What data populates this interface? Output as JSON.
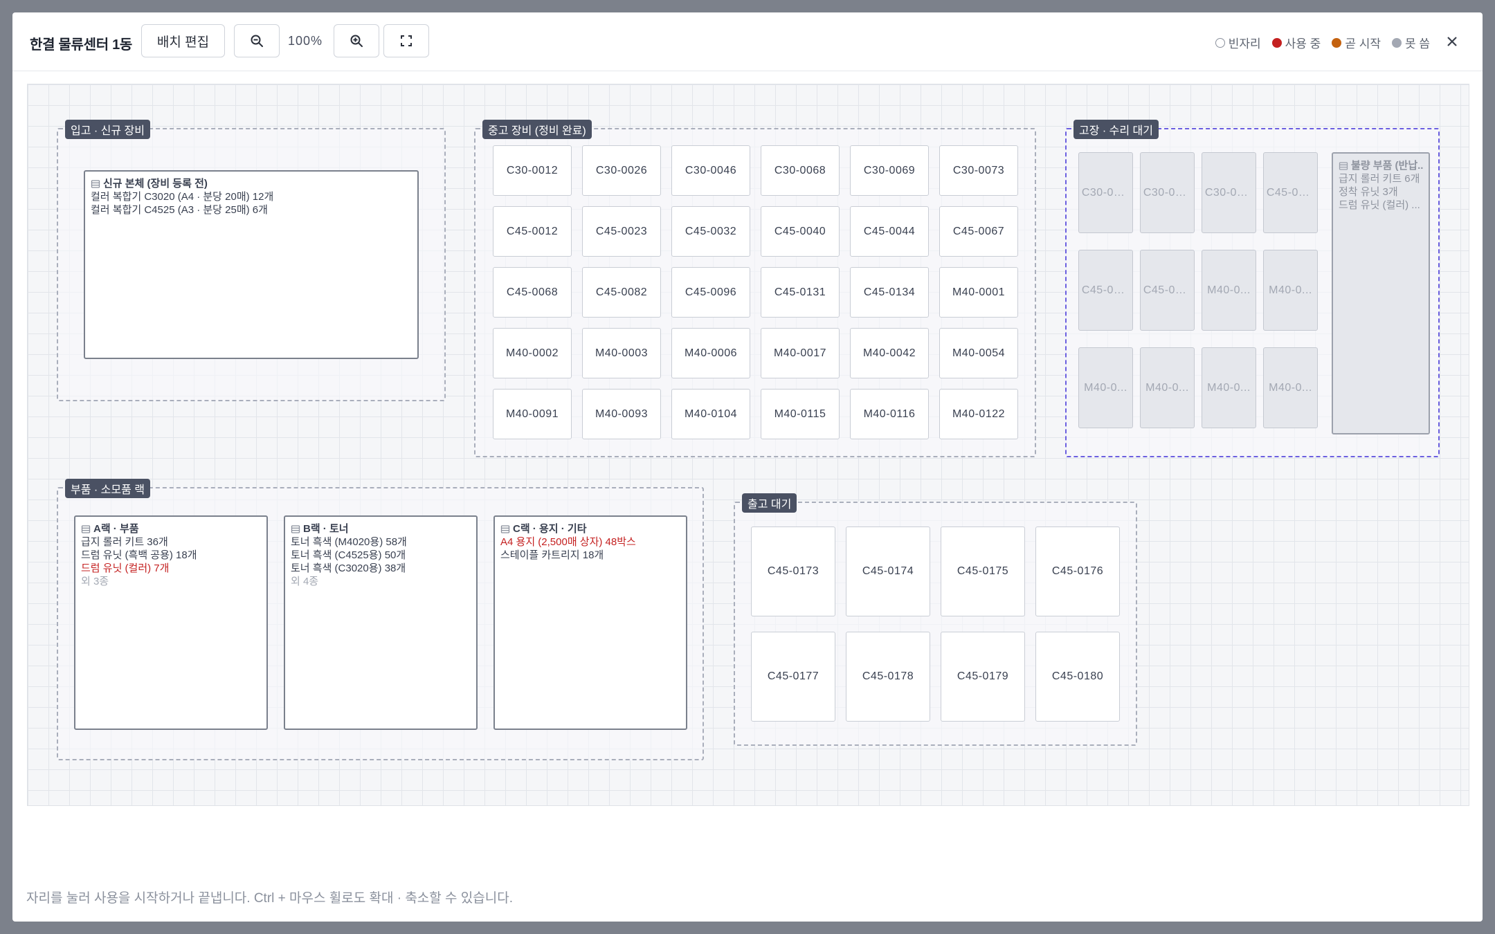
{
  "header": {
    "title": "한결 물류센터 1동",
    "edit_label": "배치 편집",
    "zoom_level": "100%",
    "zoom_out_icon": "zoom-out-icon",
    "zoom_in_icon": "zoom-in-icon",
    "fullscreen_icon": "fullscreen-icon",
    "close_icon": "close-icon"
  },
  "legend": [
    {
      "label": "빈자리",
      "color": "#ffffff",
      "border": "#8a909c"
    },
    {
      "label": "사용 중",
      "color": "#c42020",
      "border": "#c42020"
    },
    {
      "label": "곧 시작",
      "color": "#c4620f",
      "border": "#c4620f"
    },
    {
      "label": "못 씀",
      "color": "#a3a8b3",
      "border": "#a3a8b3"
    }
  ],
  "zones": {
    "intake": {
      "label": "입고 · 신규 장비",
      "box": {
        "title": "신규 본체 (장비 등록 전)",
        "lines": [
          "컬러 복합기 C3020 (A4 · 분당 20매) 12개",
          "컬러 복합기 C4525 (A3 · 분당 25매) 6개"
        ]
      }
    },
    "used": {
      "label": "중고 장비 (정비 완료)",
      "seats": [
        "C30-0012",
        "C30-0026",
        "C30-0046",
        "C30-0068",
        "C30-0069",
        "C30-0073",
        "C45-0012",
        "C45-0023",
        "C45-0032",
        "C45-0040",
        "C45-0044",
        "C45-0067",
        "C45-0068",
        "C45-0082",
        "C45-0096",
        "C45-0131",
        "C45-0134",
        "M40-0001",
        "M40-0002",
        "M40-0003",
        "M40-0006",
        "M40-0017",
        "M40-0042",
        "M40-0054",
        "M40-0091",
        "M40-0093",
        "M40-0104",
        "M40-0115",
        "M40-0116",
        "M40-0122"
      ]
    },
    "repair": {
      "label": "고장 · 수리 대기",
      "seats": [
        "C30-00...",
        "C30-00...",
        "C30-00...",
        "C45-00...",
        "C45-00...",
        "C45-00...",
        "M40-0...",
        "M40-0...",
        "M40-0...",
        "M40-0...",
        "M40-0...",
        "M40-0..."
      ],
      "box": {
        "title": "불량 부품 (반납...",
        "lines": [
          "급지 롤러 키트 6개",
          "정착 유닛 3개",
          "드럼 유닛 (컬러) ..."
        ]
      }
    },
    "parts": {
      "label": "부품 · 소모품 랙",
      "racks": [
        {
          "title": "A랙 · 부품",
          "lines": [
            {
              "text": "급지 롤러 키트 36개",
              "alert": false
            },
            {
              "text": "드럼 유닛 (흑백 공용) 18개",
              "alert": false
            },
            {
              "text": "드럼 유닛 (컬러) 7개",
              "alert": true
            }
          ],
          "more": "외 3종"
        },
        {
          "title": "B랙 · 토너",
          "lines": [
            {
              "text": "토너 흑색 (M4020용) 58개",
              "alert": false
            },
            {
              "text": "토너 흑색 (C4525용) 50개",
              "alert": false
            },
            {
              "text": "토너 흑색 (C3020용) 38개",
              "alert": false
            }
          ],
          "more": "외 4종"
        },
        {
          "title": "C랙 · 용지 · 기타",
          "lines": [
            {
              "text": "A4 용지 (2,500매 상자) 48박스",
              "alert": true
            },
            {
              "text": "스테이플 카트리지 18개",
              "alert": false
            }
          ],
          "more": ""
        }
      ]
    },
    "outbound": {
      "label": "출고 대기",
      "seats": [
        "C45-0173",
        "C45-0174",
        "C45-0175",
        "C45-0176",
        "C45-0177",
        "C45-0178",
        "C45-0179",
        "C45-0180"
      ]
    }
  },
  "footer": {
    "hint": "자리를 눌러 사용을 시작하거나 끝냅니다. Ctrl + 마우스 휠로도 확대 · 축소할 수 있습니다."
  }
}
